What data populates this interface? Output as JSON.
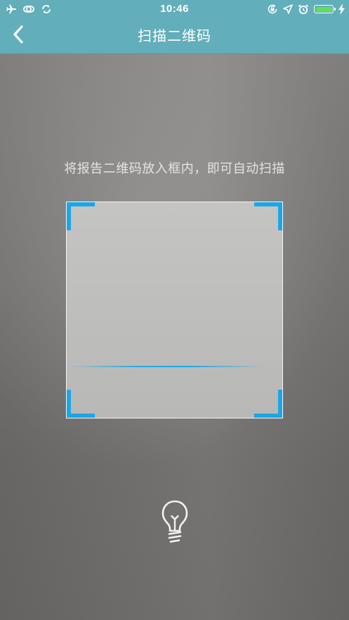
{
  "status_bar": {
    "time": "10:46",
    "left_icons": [
      "airplane-icon",
      "link-icon",
      "sync-icon"
    ],
    "right_icons": [
      "rotation-lock-icon",
      "location-icon",
      "alarm-icon",
      "battery-icon",
      "charging-bolt-icon"
    ],
    "battery_level": 1.0,
    "battery_color": "#62e052"
  },
  "nav_bar": {
    "title": "扫描二维码",
    "back_icon": "chevron-left-icon",
    "background": "#62aebb"
  },
  "scanner": {
    "hint": "将报告二维码放入框内，即可自动扫描",
    "corner_color": "#1aa7e6",
    "scan_line_color": "#1aa7e6",
    "torch_icon": "lightbulb-icon"
  }
}
